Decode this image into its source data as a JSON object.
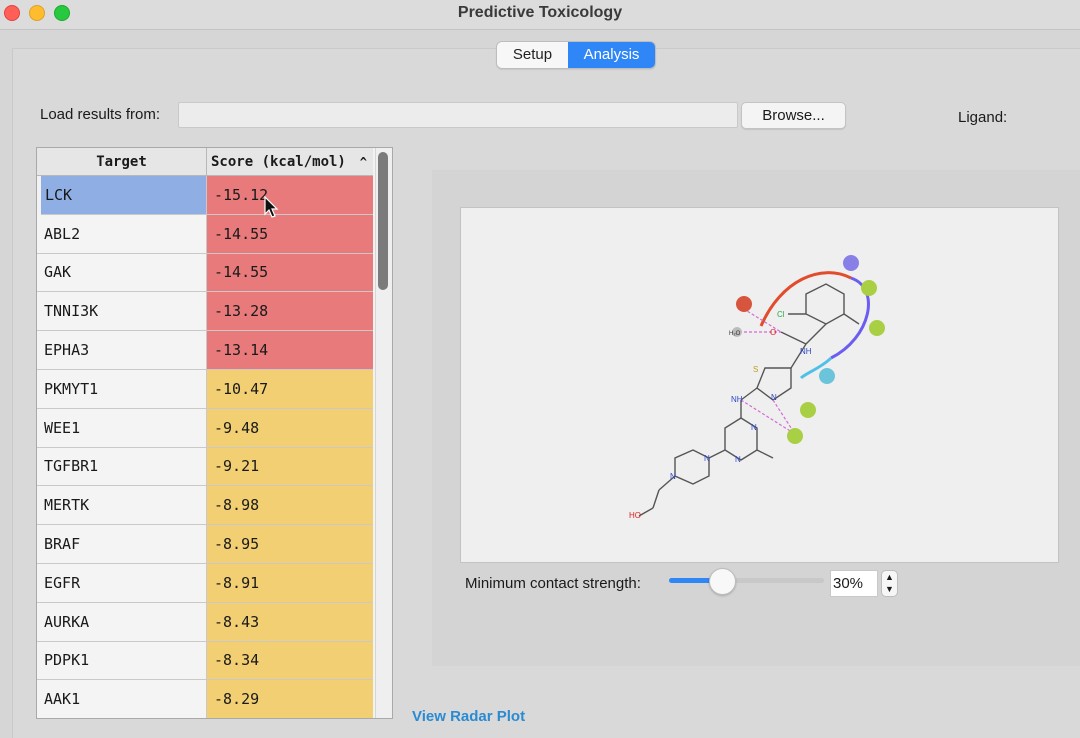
{
  "window": {
    "title": "Predictive Toxicology"
  },
  "tabs": [
    {
      "label": "Setup",
      "selected": false
    },
    {
      "label": "Analysis",
      "selected": true
    }
  ],
  "load": {
    "label": "Load results from:",
    "value": "",
    "browse_label": "Browse..."
  },
  "ligand": {
    "label": "Ligand:"
  },
  "table": {
    "columns": [
      "Target",
      "Score (kcal/mol)"
    ],
    "sort_indicator": "^",
    "rows": [
      {
        "target": "LCK",
        "score": "-15.12",
        "band": "red"
      },
      {
        "target": "ABL2",
        "score": "-14.55",
        "band": "red"
      },
      {
        "target": "GAK",
        "score": "-14.55",
        "band": "red"
      },
      {
        "target": "TNNI3K",
        "score": "-13.28",
        "band": "red"
      },
      {
        "target": "EPHA3",
        "score": "-13.14",
        "band": "red"
      },
      {
        "target": "PKMYT1",
        "score": "-10.47",
        "band": "yellow"
      },
      {
        "target": "WEE1",
        "score": "-9.48",
        "band": "yellow"
      },
      {
        "target": "TGFBR1",
        "score": "-9.21",
        "band": "yellow"
      },
      {
        "target": "MERTK",
        "score": "-8.98",
        "band": "yellow"
      },
      {
        "target": "BRAF",
        "score": "-8.95",
        "band": "yellow"
      },
      {
        "target": "EGFR",
        "score": "-8.91",
        "band": "yellow"
      },
      {
        "target": "AURKA",
        "score": "-8.43",
        "band": "yellow"
      },
      {
        "target": "PDPK1",
        "score": "-8.34",
        "band": "yellow"
      },
      {
        "target": "AAK1",
        "score": "-8.29",
        "band": "yellow"
      }
    ]
  },
  "colors": {
    "red": "#e87a7c",
    "yellow": "#f2cf72",
    "selected": "#8eaee4",
    "accent": "#2f86f6",
    "link": "#2a8ad2"
  },
  "slider": {
    "label": "Minimum contact strength:",
    "value_text": "30%",
    "fraction": 0.3
  },
  "diagram_labels": {
    "cl": "Cl",
    "o": "O",
    "s": "S",
    "n": "N",
    "nh": "NH",
    "h": "H",
    "ho": "HO",
    "h2o": "H₂O"
  },
  "radar_link": "View Radar Plot"
}
